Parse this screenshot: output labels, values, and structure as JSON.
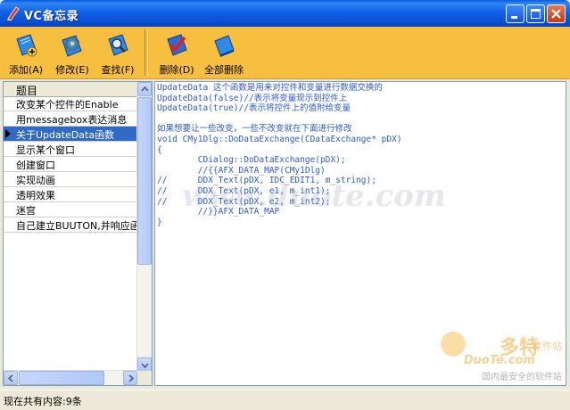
{
  "window": {
    "title": "VC备忘录",
    "icon": "pen-icon",
    "buttons": [
      "minimize-icon",
      "maximize-icon",
      "close-icon"
    ]
  },
  "toolbar": {
    "add_label": "添加(A)",
    "edit_label": "修改(E)",
    "find_label": "查找(F)",
    "delete_label": "删除(D)",
    "delete_all_label": "全部删除"
  },
  "list": {
    "header": "题目",
    "items": [
      "改变某个控件的Enable",
      "用messagebox表达消息",
      "关于UpdateData函数",
      "显示某个窗口",
      "创建窗口",
      "实现动画",
      "透明效果",
      "迷宫",
      "自己建立BUUTON,并响应函"
    ],
    "selected_index": 2
  },
  "content": {
    "lines": [
      "UpdateData 这个函数是用来对控件和变量进行数据交换的",
      "UpdateData(false)//表示将变量现示到控件上",
      "UpdateData(true)//表示将控件上的值附给变量",
      "",
      "如果想要让一些改变，一些不改变就在下面进行修改",
      "void CMy1Dlg::DoDataExchange(CDataExchange* pDX)",
      "{",
      "        CDialog::DoDataExchange(pDX);",
      "        //{{AFX_DATA_MAP(CMy1Dlg)",
      "//      DDX_Text(pDX, IDC_EDIT1, m_string);",
      "//      DDX_Text(pDX, e1, m_int1);",
      "//      DDX_Text(pDX, e2, m_int2);",
      "        //}}AFX_DATA_MAP",
      "}"
    ],
    "text_color": "#2E58D6"
  },
  "watermark": {
    "url": "www.duote.com",
    "logo_main": "多特",
    "logo_sub": "软件站",
    "logo_en": "DuoTe.com",
    "slogan": "国内最安全的软件站"
  },
  "statusbar": {
    "text": "现在共有内容:9条"
  },
  "colors": {
    "titlebar": "#0A4FD6",
    "toolbar": "#F7BF3F",
    "selection": "#316AC5"
  }
}
